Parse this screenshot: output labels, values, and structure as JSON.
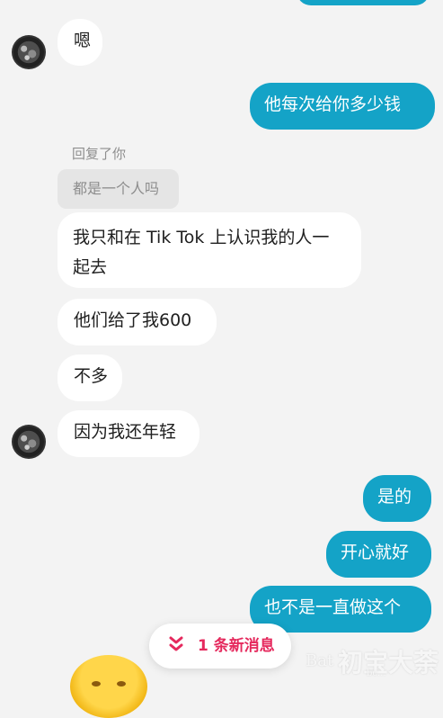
{
  "colors": {
    "background": "#f3f3f3",
    "incoming_bubble": "#ffffff",
    "outgoing_bubble": "#14a3c7",
    "new_message_accent": "#e5295d"
  },
  "messages": {
    "incoming_1": "嗯",
    "outgoing_1": "他每次给你多少钱",
    "reply_label": "回复了你",
    "quoted_text": "都是一个人吗",
    "incoming_2": "我只和在 Tik Tok 上认识我的人一起去",
    "incoming_3": "他们给了我600",
    "incoming_4": "不多",
    "incoming_5": "因为我还年轻",
    "outgoing_2": "是的",
    "outgoing_3": "开心就好",
    "outgoing_4": "也不是一直做这个"
  },
  "new_message_banner": {
    "icon": "double-chevron-down-icon",
    "text": "1 条新消息"
  },
  "watermark": {
    "mark1": "Bat",
    "mark2": "初宝大荼",
    "mark3": "bc..."
  }
}
